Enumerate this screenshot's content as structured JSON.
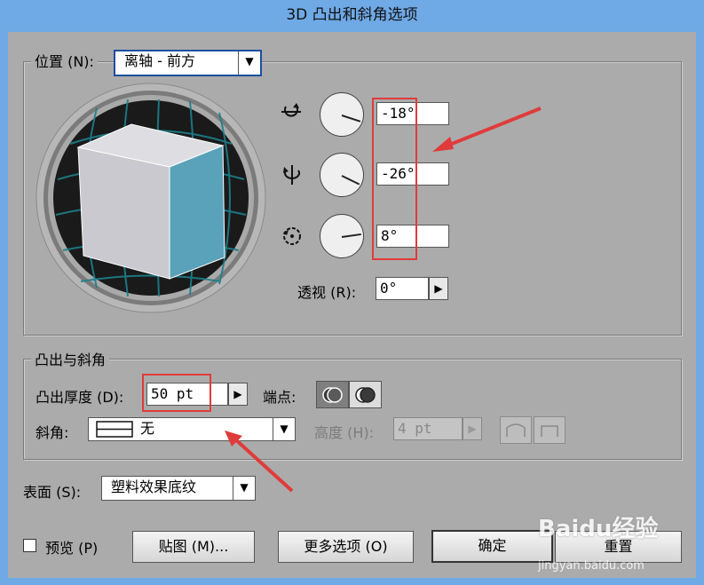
{
  "window": {
    "title": "3D 凸出和斜角选项"
  },
  "position": {
    "group_label": "位置 (N):",
    "preset": "离轴 - 前方",
    "x_rotation": "-18°",
    "y_rotation": "-26°",
    "z_rotation": "8°",
    "perspective_label": "透视 (R):",
    "perspective_value": "0°"
  },
  "extrude": {
    "group_label": "凸出与斜角",
    "depth_label": "凸出厚度 (D):",
    "depth_value": "50 pt",
    "cap_label": "端点:",
    "bevel_label": "斜角:",
    "bevel_value": "无",
    "height_label": "高度 (H):",
    "height_value": "4 pt"
  },
  "surface": {
    "label": "表面 (S):",
    "value": "塑料效果底纹"
  },
  "footer": {
    "preview_label": "预览 (P)",
    "map_button": "贴图 (M)...",
    "more_button": "更多选项 (O)",
    "ok_button": "确定",
    "reset_button": "重置"
  },
  "watermark": {
    "brand": "Baidu经验",
    "url": "jingyan.baidu.com"
  },
  "colors": {
    "titlebar": "#6fa9e6",
    "panel": "#ababab",
    "cube_front": "#5aa2ba",
    "cube_top": "#dedee2",
    "cube_side": "#c9c9cf",
    "highlight": "#e03b3b"
  }
}
